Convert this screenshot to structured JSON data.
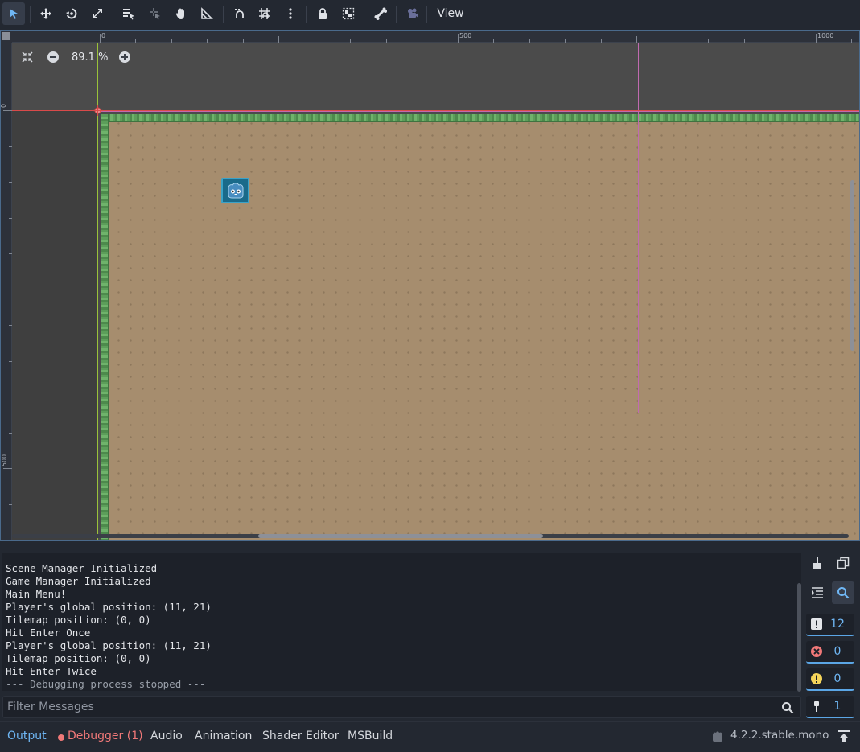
{
  "toolbar": {
    "tools": [
      {
        "name": "select-tool",
        "icon": "cursor-arrow-icon",
        "active": true
      },
      {
        "name": "move-tool",
        "icon": "move-cross-icon"
      },
      {
        "name": "rotate-tool",
        "icon": "rotate-icon"
      },
      {
        "name": "scale-tool",
        "icon": "scale-icon"
      },
      {
        "name": "list-select-tool",
        "icon": "list-select-icon"
      },
      {
        "name": "pivot-tool",
        "icon": "pivot-icon"
      },
      {
        "name": "pan-tool",
        "icon": "hand-icon"
      },
      {
        "name": "ruler-tool",
        "icon": "ruler-icon"
      },
      {
        "name": "smart-snap-toggle",
        "icon": "smart-snap-icon"
      },
      {
        "name": "grid-snap-toggle",
        "icon": "grid-snap-icon"
      },
      {
        "name": "snap-options-menu",
        "icon": "kebab-menu-icon"
      },
      {
        "name": "lock-button",
        "icon": "lock-icon"
      },
      {
        "name": "group-button",
        "icon": "group-icon"
      },
      {
        "name": "bone-button",
        "icon": "bone-icon"
      },
      {
        "name": "camera-override-button",
        "icon": "camera-icon"
      }
    ],
    "view_label": "View"
  },
  "viewport": {
    "zoom_text": "89.1 %",
    "ruler_top_labels": [
      "0",
      "500",
      "1000"
    ],
    "ruler_left_labels": [
      "0",
      "500"
    ]
  },
  "output": {
    "lines": [
      "Scene Manager Initialized",
      "Game Manager Initialized",
      "Main Menu!",
      "Player's global position: (11, 21)",
      "Tilemap position: (0, 0)",
      "Hit Enter Once",
      "Player's global position: (11, 21)",
      "Tilemap position: (0, 0)",
      "Hit Enter Twice",
      "--- Debugging process stopped ---"
    ],
    "filter_placeholder": "Filter Messages",
    "counters": {
      "messages": "12",
      "errors": "0",
      "warnings": "0",
      "editor": "1"
    }
  },
  "bottom_tabs": {
    "output": "Output",
    "debugger": "Debugger (1)",
    "audio": "Audio",
    "animation": "Animation",
    "shader_editor": "Shader Editor",
    "msbuild": "MSBuild"
  },
  "version": "4.2.2.stable.mono",
  "colors": {
    "accent": "#6fb7f5",
    "error": "#f07878",
    "background": "#232831",
    "terrain": "#a68d6e",
    "grass": "#5c9e5a"
  }
}
